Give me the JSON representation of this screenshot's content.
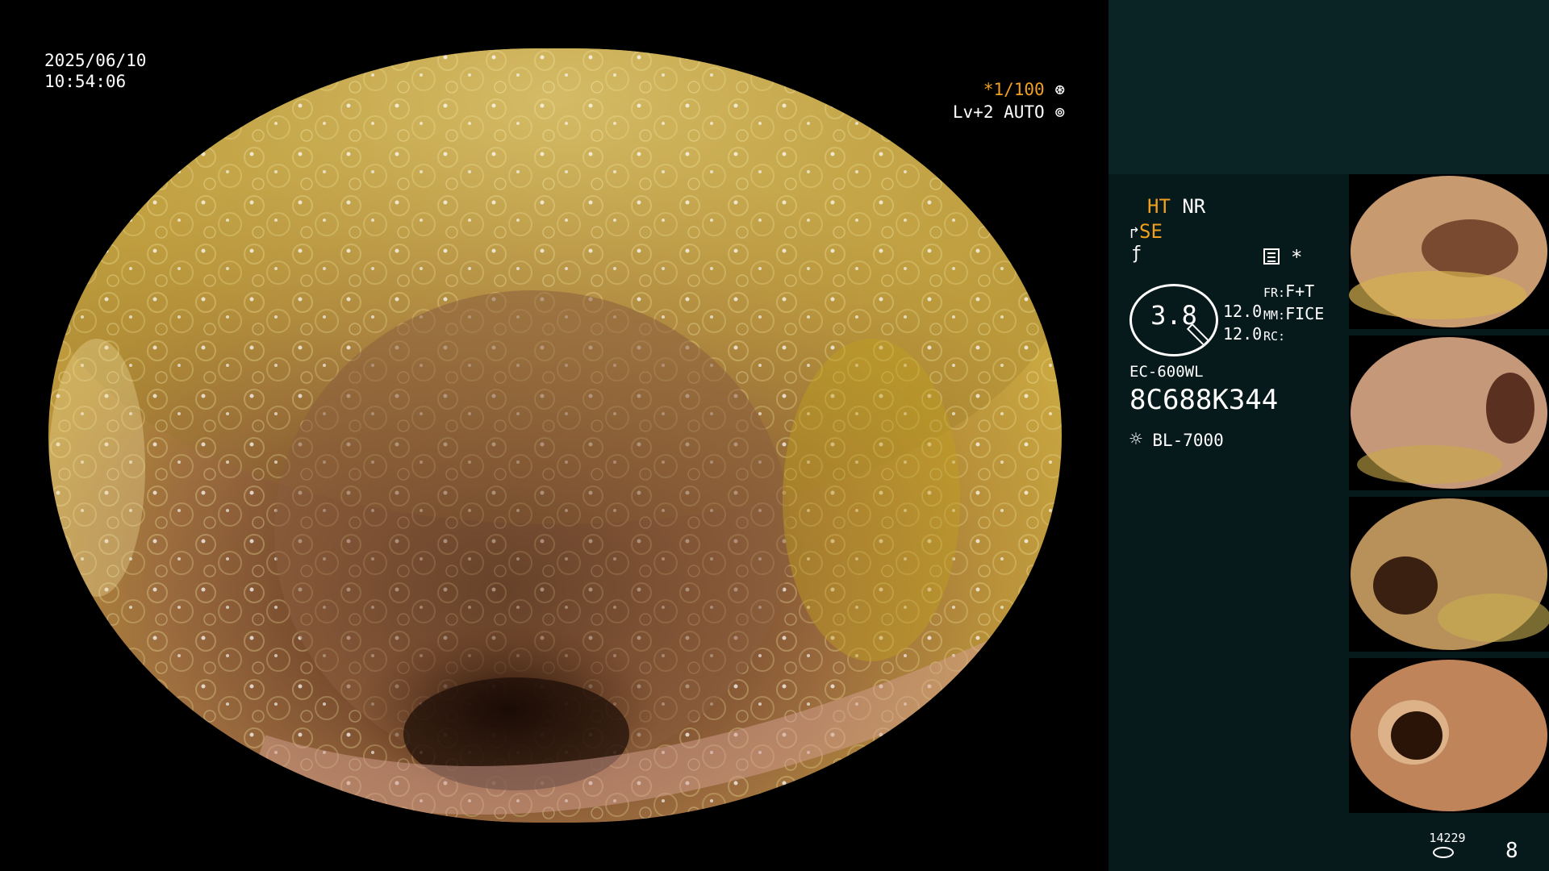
{
  "main_view": {
    "date": "2025/06/10",
    "time": "10:54:06",
    "shutter": "*1/100",
    "shutter_icon": "aperture-icon",
    "level": "Lv+2 AUTO",
    "level_icon": "iris-icon"
  },
  "panel": {
    "ht": "HT",
    "nr": "NR",
    "se": "SE",
    "se_icon": "scope-tip-icon",
    "f_icon": "f-hook-icon",
    "settings_icon": "list-icon",
    "asterisk": "*",
    "zoom_value": "3.8",
    "value_a": "12.0",
    "value_b": "12.0",
    "fr_label": "FR:",
    "fr_value": "F+T",
    "mm_label": "MM:",
    "mm_value": "FICE",
    "rc_label": "RC:",
    "scope_model": "EC-600WL",
    "serial": "8C688K344",
    "light_icon": "sun-icon",
    "light_source": "BL-7000",
    "counter": "14229",
    "counter_icon": "disk-stack-icon",
    "image_count": "8"
  },
  "thumbnails": [
    {
      "name": "thumb-1",
      "tint": "#c89a70"
    },
    {
      "name": "thumb-2",
      "tint": "#c49878"
    },
    {
      "name": "thumb-3",
      "tint": "#b8905a"
    },
    {
      "name": "thumb-4",
      "tint": "#c0845a"
    }
  ]
}
